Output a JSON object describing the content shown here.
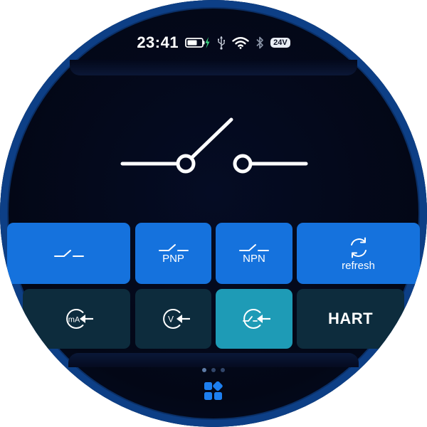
{
  "status_bar": {
    "time": "23:41",
    "battery_icon": "battery-charging-icon",
    "charging_icon": "lightning-icon",
    "usb_icon": "usb-icon",
    "wifi_icon": "wifi-icon",
    "bluetooth_icon": "bluetooth-icon",
    "voltage": "24V"
  },
  "main_display": {
    "icon": "open-switch-icon"
  },
  "buttons_row1": [
    {
      "icon": "switch-contact-icon",
      "label": ""
    },
    {
      "icon": "switch-contact-icon",
      "label": "PNP"
    },
    {
      "icon": "switch-contact-icon",
      "label": "NPN"
    },
    {
      "icon": "refresh-icon",
      "label": "refresh"
    }
  ],
  "buttons_row2": [
    {
      "icon": "ma-input-icon",
      "icon_text": "mA",
      "active": false
    },
    {
      "icon": "v-input-icon",
      "icon_text": "V",
      "active": false
    },
    {
      "icon": "switch-input-icon",
      "icon_text": "",
      "active": true
    },
    {
      "label": "HART",
      "active": false
    }
  ],
  "pager": {
    "dots": 3,
    "active_index": 0
  },
  "bottom": {
    "icon": "apps-grid-icon"
  },
  "colors": {
    "background": "#030716",
    "bezel": "#0d3f86",
    "blue_button": "#1572dd",
    "dark_button": "#0d2c3d",
    "active_button": "#1e9bb6",
    "charging": "#3ddc84"
  }
}
